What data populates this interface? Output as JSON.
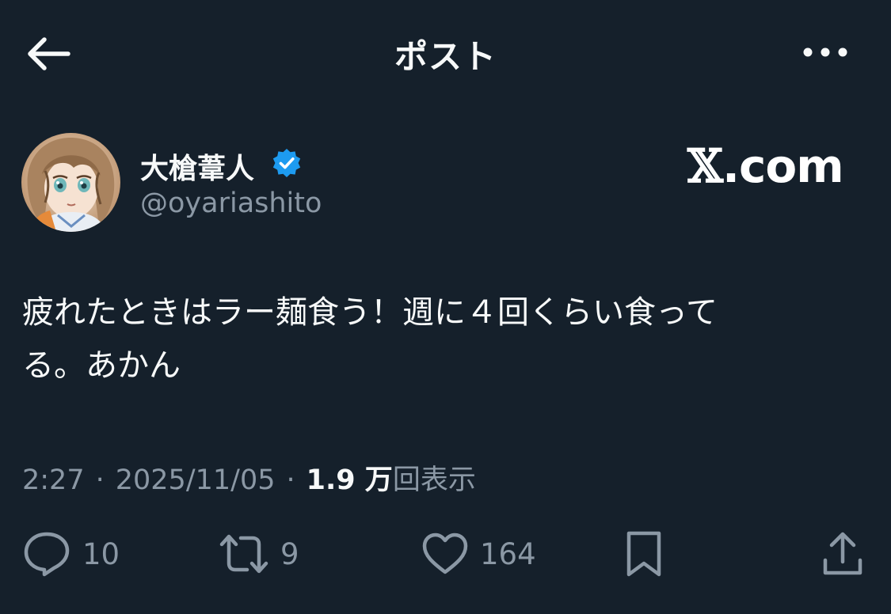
{
  "header": {
    "title": "ポスト",
    "back_icon": "arrow-left-icon",
    "more_icon": "more-horizontal-icon"
  },
  "author": {
    "name": "大槍葦人",
    "handle": "@oyariashito",
    "verified": true,
    "verified_color": "#1d9bf0"
  },
  "brand": {
    "x_glyph": "𝕏",
    "domain_text": ".com"
  },
  "post": {
    "text": "疲れたときはラー麺食う！週に４回くらい食って\nる。あかん"
  },
  "meta": {
    "time": "2:27",
    "separator": "·",
    "date": "2025/11/05",
    "views_count": "1.9 万",
    "views_label": "回表示"
  },
  "actions": {
    "reply_count": "10",
    "repost_count": "9",
    "like_count": "164"
  },
  "colors": {
    "background": "#15202b",
    "primary_text": "#f7f9f9",
    "secondary_text": "#8b98a5"
  }
}
